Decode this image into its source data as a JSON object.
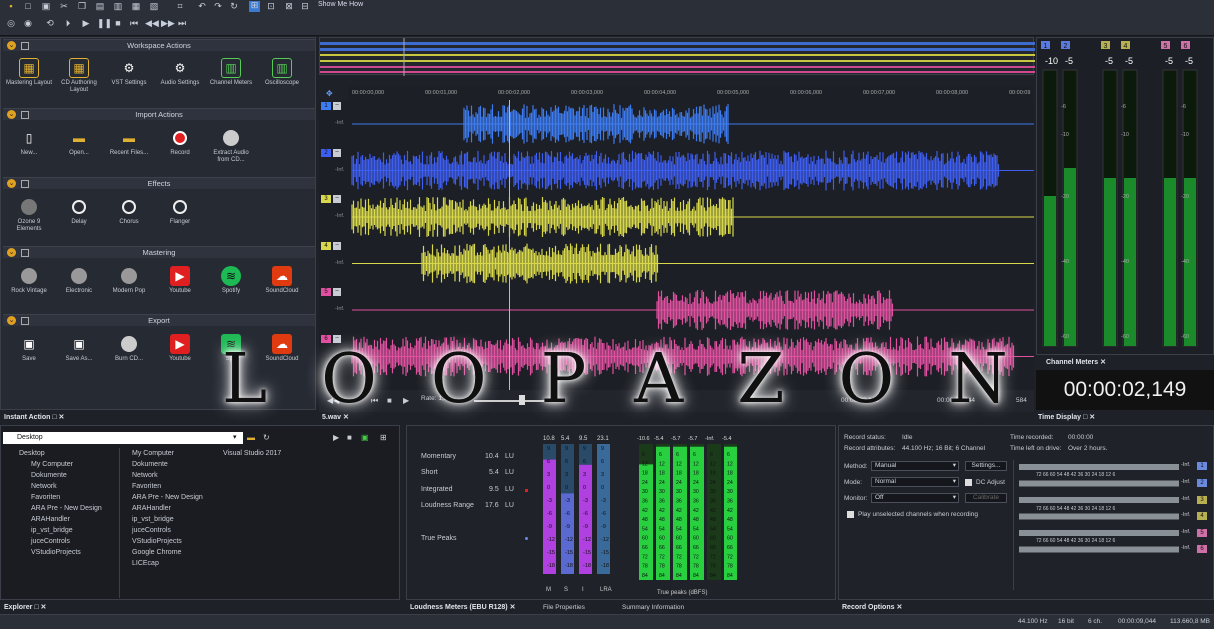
{
  "toolbar": {
    "show_me_how": "Show Me How"
  },
  "workspace": {
    "sections": [
      {
        "title": "Workspace Actions",
        "items": [
          "Mastering Layout",
          "CD Authoring Layout",
          "VST Settings",
          "Audio Settings",
          "Channel Meters",
          "Oscilloscope"
        ]
      },
      {
        "title": "Import Actions",
        "items": [
          "New...",
          "Open...",
          "Recent Files...",
          "Record",
          "Extract Audio from CD..."
        ]
      },
      {
        "title": "Effects",
        "items": [
          "Ozone 9 Elements",
          "Delay",
          "Chorus",
          "Flanger"
        ]
      },
      {
        "title": "Mastering",
        "items": [
          "Rock Vintage",
          "Electronic",
          "Modern Pop",
          "Youtube",
          "Spotify",
          "SoundCloud"
        ]
      },
      {
        "title": "Export",
        "items": [
          "Save",
          "Save As...",
          "Burn CD...",
          "Youtube",
          "Spo",
          "SoundCloud"
        ]
      }
    ]
  },
  "ruler": [
    "00:00:00,000",
    "00:00:01,000",
    "00:00:02,000",
    "00:00:03,000",
    "00:00:04,000",
    "00:00:05,000",
    "00:00:06,000",
    "00:00:07,000",
    "00:00:08,000",
    "00:00:09"
  ],
  "tracks": [
    {
      "num": "1",
      "inf": "-Inf.",
      "color": "#3d7bf0"
    },
    {
      "num": "2",
      "inf": "-Inf.",
      "color": "#3d5ef0"
    },
    {
      "num": "3",
      "inf": "-Inf.",
      "color": "#d8d84a"
    },
    {
      "num": "4",
      "inf": "-Inf.",
      "color": "#d8d84a"
    },
    {
      "num": "5",
      "inf": "-Inf.",
      "color": "#e050a0"
    },
    {
      "num": "6",
      "inf": "-Inf.",
      "color": "#e050a0"
    }
  ],
  "transport": {
    "rate": "Rate: 1,0",
    "pos": "00:00:02,149",
    "end": "00:00:09,044",
    "extra": "584"
  },
  "watermark": "LOOPAZON",
  "meters": {
    "ch": [
      "1",
      "2",
      "3",
      "4",
      "5",
      "6"
    ],
    "peaks": [
      "-10",
      "-5",
      "-5",
      "-5",
      "-5",
      "-5"
    ],
    "peak_subs": [
      "6",
      "4",
      "7",
      "4",
      "6",
      "4"
    ],
    "scale": [
      "-6",
      "-10",
      "-20",
      "-40",
      "-60"
    ],
    "title": "Channel Meters"
  },
  "time_display": {
    "value": "00:00:02,149",
    "title": "Time Display"
  },
  "panels": {
    "instant_action": "Instant Action",
    "wav_tab": "5.wav",
    "explorer": "Explorer",
    "loudness": "Loudness Meters (EBU R128)",
    "file_props": "File Properties",
    "summary": "Summary Information",
    "record_options": "Record Options"
  },
  "explorer": {
    "location": "Desktop",
    "tree": [
      "Desktop",
      "My Computer",
      "Dokumente",
      "Network",
      "Favoriten",
      "ARA Pre - New Design",
      "ARAHandler",
      "ip_vst_bridge",
      "juceControls",
      "VStudioProjects"
    ],
    "files": [
      "My Computer",
      "Dokumente",
      "Network",
      "Favoriten",
      "ARA Pre - New Design",
      "ARAHandler",
      "ip_vst_bridge",
      "juceControls",
      "VStudioProjects",
      "Google Chrome",
      "LICEcap"
    ],
    "vs": "Visual Studio 2017"
  },
  "loudness": {
    "rows": [
      {
        "label": "Momentary",
        "value": "10.4",
        "unit": "LU"
      },
      {
        "label": "Short",
        "value": "5.4",
        "unit": "LU"
      },
      {
        "label": "Integrated",
        "value": "9.5",
        "unit": "LU"
      },
      {
        "label": "Loudness Range",
        "value": "17.6",
        "unit": "LU"
      }
    ],
    "true_peaks": "True Peaks",
    "bar_tops": [
      "10.8",
      "5.4",
      "9.5",
      "23.1"
    ],
    "bar_labels": [
      "M",
      "S",
      "I",
      "LRA"
    ],
    "scale": [
      "9",
      "6",
      "3",
      "0",
      "-3",
      "-6",
      "-9",
      "-12",
      "-15",
      "-18"
    ],
    "tp_tops": [
      "-10.6",
      "-5.4",
      "-5.7",
      "-5.7",
      "-Inf.",
      "-5.4"
    ],
    "tp_scale": [
      "6",
      "12",
      "18",
      "24",
      "30",
      "36",
      "42",
      "48",
      "54",
      "60",
      "66",
      "72",
      "78",
      "84"
    ],
    "tp_label": "True peaks (dBFS)"
  },
  "record": {
    "status_label": "Record status:",
    "status": "Idle",
    "attrs_label": "Record attributes:",
    "attrs": "44.100 Hz; 16 Bit; 6 Channel",
    "time_rec_label": "Time recorded:",
    "time_rec": "00:00:00",
    "time_left_label": "Time left on drive:",
    "time_left": "Over 2 hours.",
    "method_label": "Method:",
    "method": "Manual",
    "settings": "Settings...",
    "mode_label": "Mode:",
    "mode": "Normal",
    "dc": "DC Adjust",
    "monitor_label": "Monitor:",
    "monitor": "Off",
    "calibrate": "Calibrate",
    "play_unsel": "Play unselected channels when recording",
    "scale": "72  66  60  54  48  42  36  30  24  18  12   6",
    "inf": "-Inf."
  },
  "status": {
    "rate": "44.100 Hz",
    "bits": "16 bit",
    "ch": "6 ch.",
    "time": "00:00:09,044",
    "size": "113.660,8 MB"
  }
}
